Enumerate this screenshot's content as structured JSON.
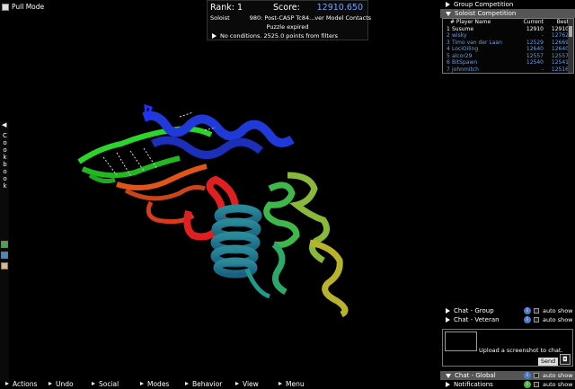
{
  "top_left": {
    "mode_label": "Pull Mode"
  },
  "score_panel": {
    "rank_label": "Rank: 1",
    "score_label": "Score:",
    "score_value": "12910.650",
    "player_type": "Soloist",
    "puzzle_name": "980: Post-CASP Tc84...ver Model Contacts",
    "puzzle_status": "Puzzle expired",
    "conditions": "No conditions. 2525.0 points from filters"
  },
  "right_panel": {
    "group_competition": "Group Competition",
    "soloist_competition": "Soloist Competition",
    "leaderboard": {
      "headers": {
        "rank_name": "# Player Name",
        "current": "Current",
        "best": "Best"
      },
      "rows": [
        {
          "rank": "1",
          "name": "Susume",
          "current": "12910",
          "best": "12910",
          "me": true
        },
        {
          "rank": "2",
          "name": "wisky",
          "current": "-",
          "best": "12762",
          "me": false
        },
        {
          "rank": "3",
          "name": "Timo van der Laan",
          "current": "12529",
          "best": "12669",
          "me": false
        },
        {
          "rank": "4",
          "name": "LociOiling",
          "current": "12640",
          "best": "12640",
          "me": false
        },
        {
          "rank": "5",
          "name": "alcor29",
          "current": "12557",
          "best": "12557",
          "me": false
        },
        {
          "rank": "6",
          "name": "BitSpawn",
          "current": "12540",
          "best": "12541",
          "me": false
        },
        {
          "rank": "7",
          "name": "johnmitch",
          "current": "-",
          "best": "12516",
          "me": false
        }
      ]
    },
    "chats": {
      "group": "Chat - Group",
      "veteran": "Chat - Veteran",
      "global": "Chat - Global",
      "notifications": "Notifications",
      "auto_show": "auto show"
    },
    "upload_text": "Upload a screenshot to chat.",
    "send_label": "Send"
  },
  "sidebar": {
    "cookbook_label": "Cookbook"
  },
  "bottom_bar": {
    "items": [
      "Actions",
      "Undo",
      "Social",
      "Modes",
      "Behavior",
      "View",
      "Menu"
    ]
  },
  "colors": {
    "accent_blue": "#6fa8ff",
    "panel_active": "#555555",
    "info_blue": "#4a7bd0",
    "notif_green": "#3fbf3f"
  }
}
